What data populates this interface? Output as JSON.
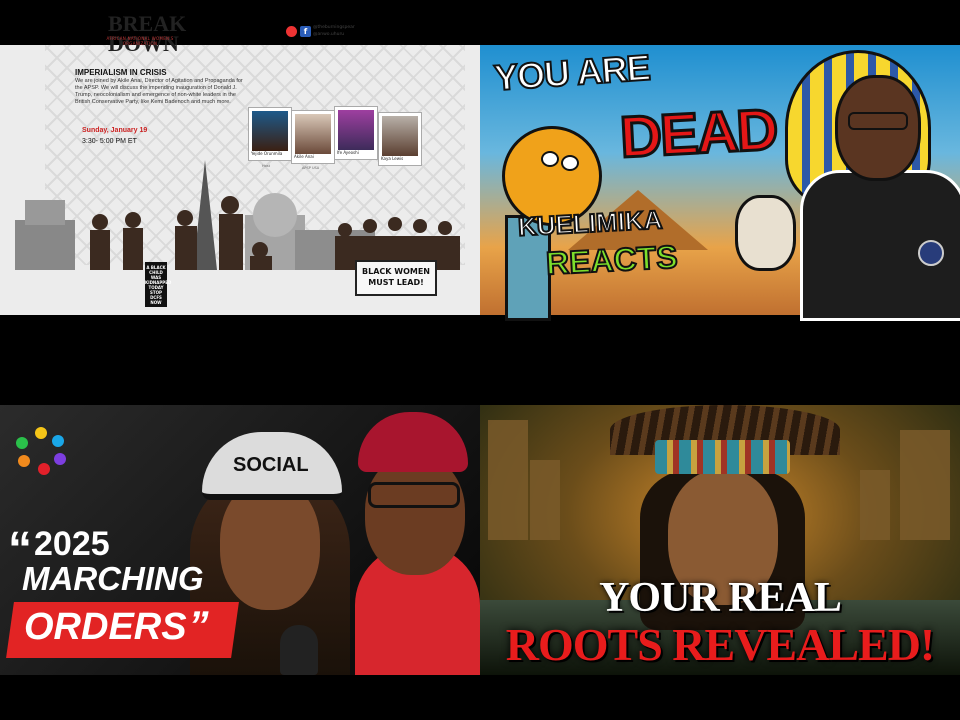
{
  "thumbnails": [
    {
      "logo_line1": "BREAK",
      "logo_line2": "DOWN",
      "logo_sub": "AFRICAN NATIONAL WOMEN'S ORGANIZATION",
      "headline": "IMPERIALISM IN CRISIS",
      "description": "We are joined by Akile Anai, Director of Agitation and Propaganda for the APSP. We will discuss the impending inauguration of Donald J. Trump, neocolonialism and emergence of non-white leaders in the British Conservative Party, like Kemi Badenoch and much more.",
      "date": "Sunday, January 19",
      "time": "3:30- 5:00 PM ET",
      "handles": [
        "@theburningspear",
        "@anwo.uhuru"
      ],
      "speakers": [
        {
          "name": "Yejide Orunmila",
          "role": "Host"
        },
        {
          "name": "Akile Anai",
          "role": "APSP USA"
        },
        {
          "name": "Ife Ayeoshi",
          "role": ""
        },
        {
          "name": "Kaya Lewis",
          "role": ""
        }
      ],
      "banner_line1": "BLACK WOMEN",
      "banner_line2": "MUST LEAD!",
      "sign_text": "A BLACK CHILD WAS KIDNAPPED TODAY STOP DCFS NOW"
    },
    {
      "line1": "YOU ARE",
      "line2": "DEAD",
      "line3": "KUELIMIKA",
      "line4": "REACTS"
    },
    {
      "cap_text": "SOCIAL",
      "line1": "2025",
      "line2": "MARCHING",
      "line3": "ORDERS",
      "open_quote": "“",
      "close_quote": "”"
    },
    {
      "line1": "YOUR REAL",
      "line2": "ROOTS REVEALED!"
    }
  ],
  "colors": {
    "dead_red": "#e41717",
    "reacts_green": "#7ddf2b",
    "orders_red": "#e22424",
    "roots_red": "#e81c1c"
  }
}
